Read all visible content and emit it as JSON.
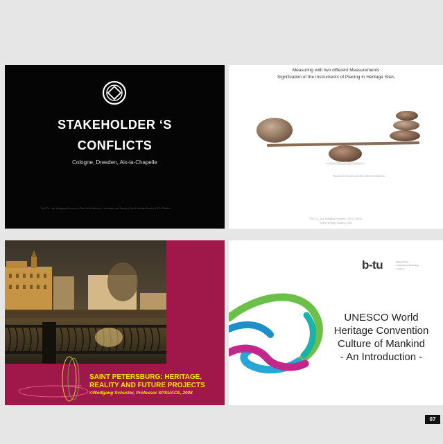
{
  "slides": [
    {
      "title_line1": "STAKEHOLDER ‘S",
      "title_line2": "CONFLICTS",
      "subtitle": "Cologne, Dresden, Aix-la-Chapelle",
      "footer": "Prof. Dr. -Ing. Wolfgang Neumann | Chair of Architecture, Landscape and Design | World Heritage Studies | BTU Cottbus",
      "logo_icon": "world-heritage-emblem-icon"
    },
    {
      "title_line1": "Measuring with two different Measurements",
      "title_line2": "Signification of the Instruments of Planing in Heritage Sites",
      "caption": "Balancing the interests and plans at World Heritage sites",
      "footer_line1": "Prof. Dr. -Ing. Wolfgang Neumann | BTU Cottbus",
      "footer_line2": "World Heritage Studies | 2008",
      "image_icon": "balance-stones-icon"
    },
    {
      "line1": "SAINT PETERSBURG: HERITAGE,",
      "line2": "REALITY AND FUTURE PROJECTS",
      "line3": "©Wolfgang Schuster, Professor SPSUACE, 2008",
      "image_icon": "city-riverfront-photo-icon"
    },
    {
      "logo_text": "b-tu",
      "logo_small1": "Brandenburg",
      "logo_small2": "University of Technology",
      "logo_small3": "Cottbus",
      "line1": "UNESCO World",
      "line2": "Heritage Convention",
      "line3": "Culture of Mankind",
      "line4": "- An Introduction -",
      "ribbon_icon": "colorful-ribbon-loop-icon"
    }
  ],
  "page_number": "07",
  "colors": {
    "page_bg": "#e6e6e6",
    "slide3_bg": "#a01749",
    "slide3_text": "#ffe600"
  }
}
